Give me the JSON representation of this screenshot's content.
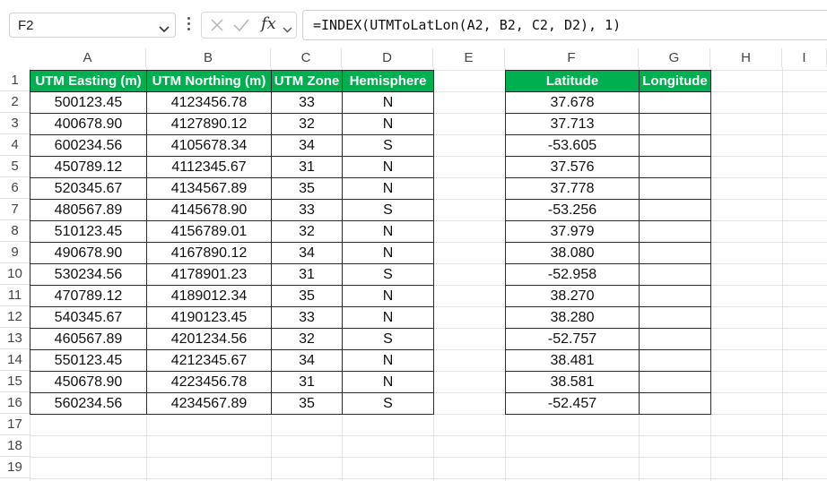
{
  "name_box": {
    "value": "F2"
  },
  "formula_bar": {
    "formula": "=INDEX(UTMToLatLon(A2, B2, C2, D2), 1)"
  },
  "columns": [
    "A",
    "B",
    "C",
    "D",
    "E",
    "F",
    "G",
    "H",
    "I"
  ],
  "rows": [
    "1",
    "2",
    "3",
    "4",
    "5",
    "6",
    "7",
    "8",
    "9",
    "10",
    "11",
    "12",
    "13",
    "14",
    "15",
    "16",
    "17",
    "18",
    "19"
  ],
  "table1": {
    "headers": [
      "UTM Easting (m)",
      "UTM Northing (m)",
      "UTM Zone",
      "Hemisphere"
    ],
    "rows": [
      [
        "500123.45",
        "4123456.78",
        "33",
        "N"
      ],
      [
        "400678.90",
        "4127890.12",
        "32",
        "N"
      ],
      [
        "600234.56",
        "4105678.34",
        "34",
        "S"
      ],
      [
        "450789.12",
        "4112345.67",
        "31",
        "N"
      ],
      [
        "520345.67",
        "4134567.89",
        "35",
        "N"
      ],
      [
        "480567.89",
        "4145678.90",
        "33",
        "S"
      ],
      [
        "510123.45",
        "4156789.01",
        "32",
        "N"
      ],
      [
        "490678.90",
        "4167890.12",
        "34",
        "N"
      ],
      [
        "530234.56",
        "4178901.23",
        "31",
        "S"
      ],
      [
        "470789.12",
        "4189012.34",
        "35",
        "N"
      ],
      [
        "540345.67",
        "4190123.45",
        "33",
        "N"
      ],
      [
        "460567.89",
        "4201234.56",
        "32",
        "S"
      ],
      [
        "550123.45",
        "4212345.67",
        "34",
        "N"
      ],
      [
        "450678.90",
        "4223456.78",
        "31",
        "N"
      ],
      [
        "560234.56",
        "4234567.89",
        "35",
        "S"
      ]
    ]
  },
  "table2": {
    "headers": [
      "Latitude",
      "Longitude"
    ],
    "rows": [
      [
        "37.678",
        ""
      ],
      [
        "37.713",
        ""
      ],
      [
        "-53.605",
        ""
      ],
      [
        "37.576",
        ""
      ],
      [
        "37.778",
        ""
      ],
      [
        "-53.256",
        ""
      ],
      [
        "37.979",
        ""
      ],
      [
        "38.080",
        ""
      ],
      [
        "-52.958",
        ""
      ],
      [
        "38.270",
        ""
      ],
      [
        "38.280",
        ""
      ],
      [
        "-52.757",
        ""
      ],
      [
        "38.481",
        ""
      ],
      [
        "38.581",
        ""
      ],
      [
        "-52.457",
        ""
      ]
    ]
  },
  "colors": {
    "header_fill": "#00b050",
    "header_text": "#ffffff",
    "gridline": "#e3e3e3"
  }
}
